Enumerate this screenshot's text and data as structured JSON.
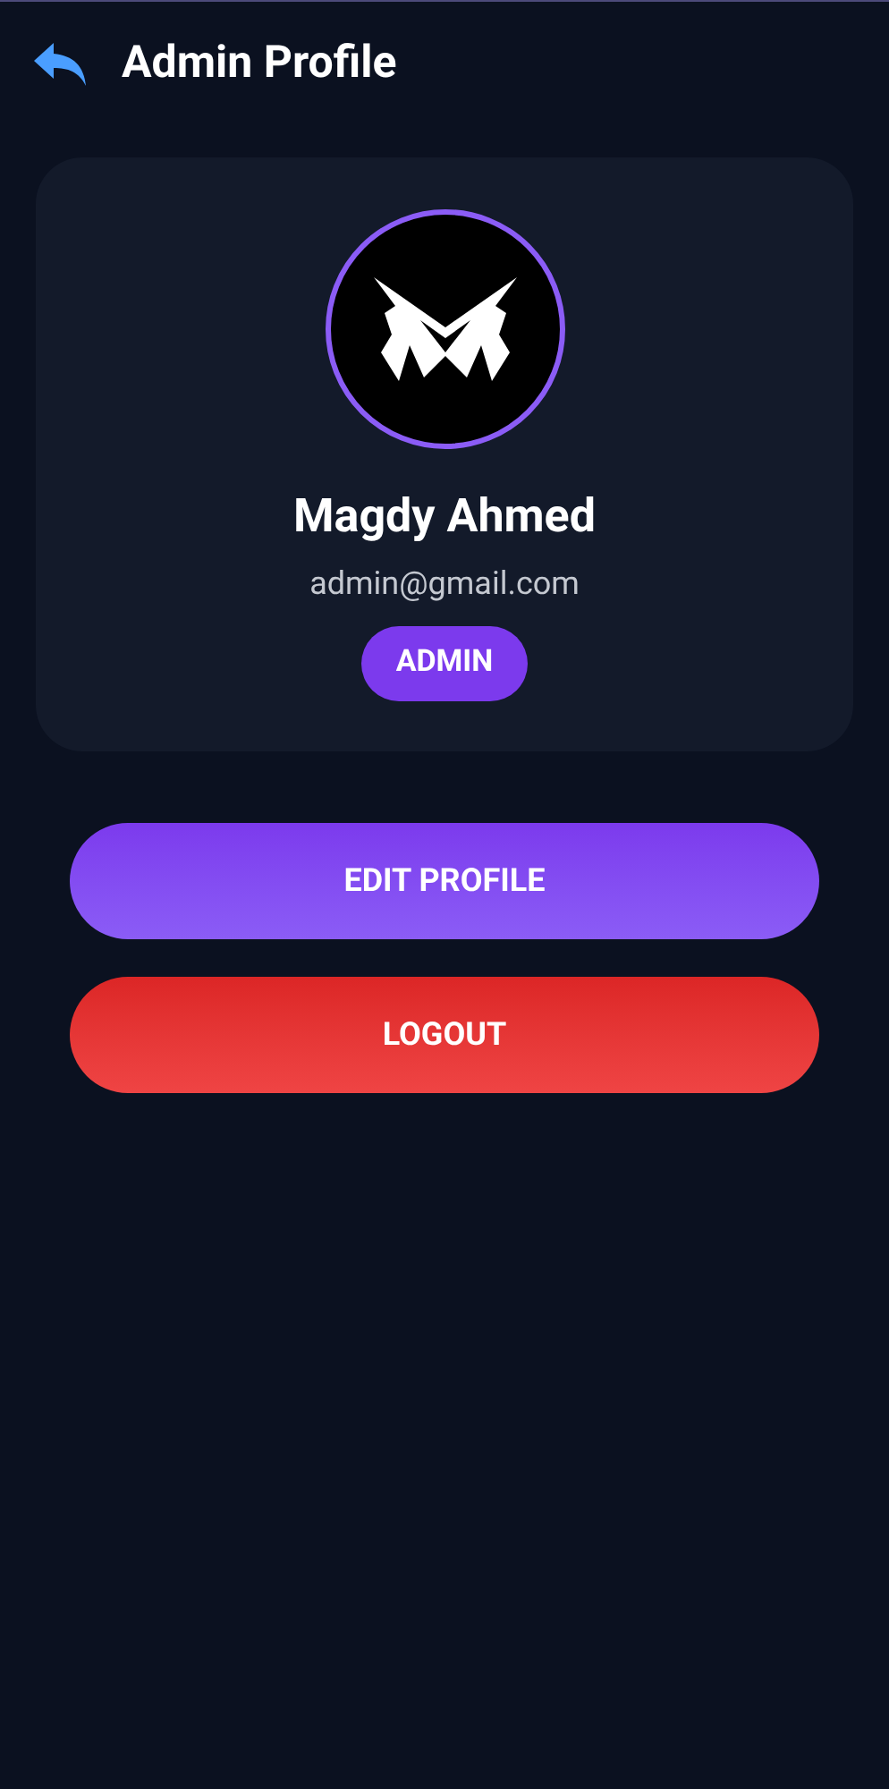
{
  "header": {
    "title": "Admin Profile"
  },
  "profile": {
    "name": "Magdy Ahmed",
    "email": "admin@gmail.com",
    "role": "ADMIN"
  },
  "actions": [
    {
      "label": "EDIT PROFILE",
      "kind": "primary"
    },
    {
      "label": "LOGOUT",
      "kind": "danger"
    }
  ]
}
